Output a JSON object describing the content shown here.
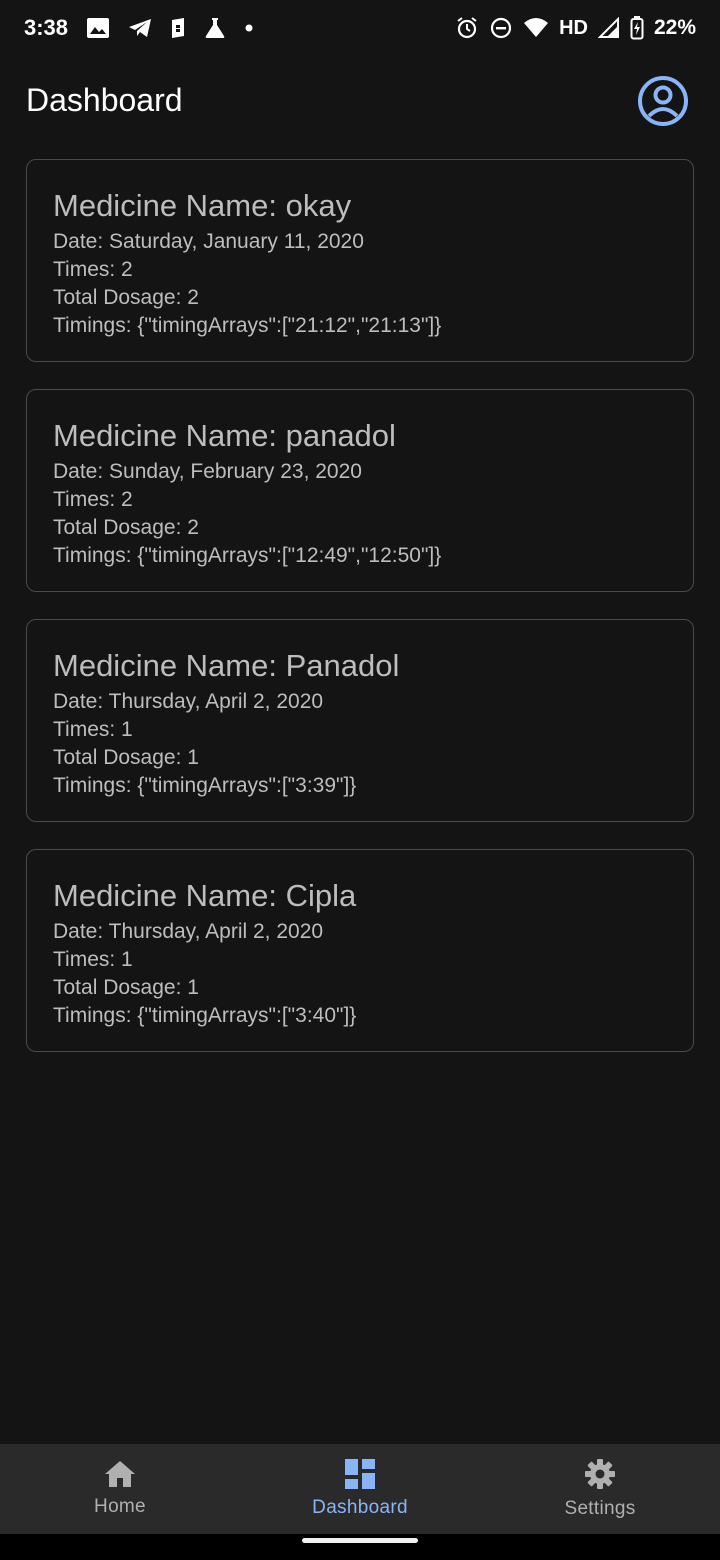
{
  "status_bar": {
    "time": "3:38",
    "left_icons": [
      "image-icon",
      "telegram-icon",
      "app-icon",
      "flask-icon",
      "dot-icon"
    ],
    "right_icons": [
      "alarm-icon",
      "dnd-icon",
      "wifi-icon",
      "signal-icon",
      "battery-icon"
    ],
    "hd_label": "HD",
    "battery_percent": "22%"
  },
  "header": {
    "title": "Dashboard",
    "profile_icon": "account-circle-icon"
  },
  "cards": [
    {
      "title": "Medicine Name: okay",
      "date": "Date: Saturday, January 11, 2020",
      "times": "Times: 2",
      "dosage": "Total Dosage: 2",
      "timings": "Timings: {\"timingArrays\":[\"21:12\",\"21:13\"]}"
    },
    {
      "title": "Medicine Name: panadol",
      "date": "Date: Sunday, February 23, 2020",
      "times": "Times: 2",
      "dosage": "Total Dosage: 2",
      "timings": "Timings: {\"timingArrays\":[\"12:49\",\"12:50\"]}"
    },
    {
      "title": "Medicine Name: Panadol",
      "date": "Date: Thursday, April 2, 2020",
      "times": "Times: 1",
      "dosage": "Total Dosage: 1",
      "timings": "Timings: {\"timingArrays\":[\"3:39\"]}"
    },
    {
      "title": "Medicine Name: Cipla",
      "date": "Date: Thursday, April 2, 2020",
      "times": "Times: 1",
      "dosage": "Total Dosage: 1",
      "timings": "Timings: {\"timingArrays\":[\"3:40\"]}"
    }
  ],
  "bottom_nav": {
    "items": [
      {
        "label": "Home",
        "icon": "home-icon",
        "active": false
      },
      {
        "label": "Dashboard",
        "icon": "dashboard-icon",
        "active": true
      },
      {
        "label": "Settings",
        "icon": "gear-icon",
        "active": false
      }
    ]
  },
  "colors": {
    "background": "#141414",
    "accent": "#8ab4f8",
    "nav_background": "#2a2a2a",
    "card_border": "#4a4a4a"
  }
}
